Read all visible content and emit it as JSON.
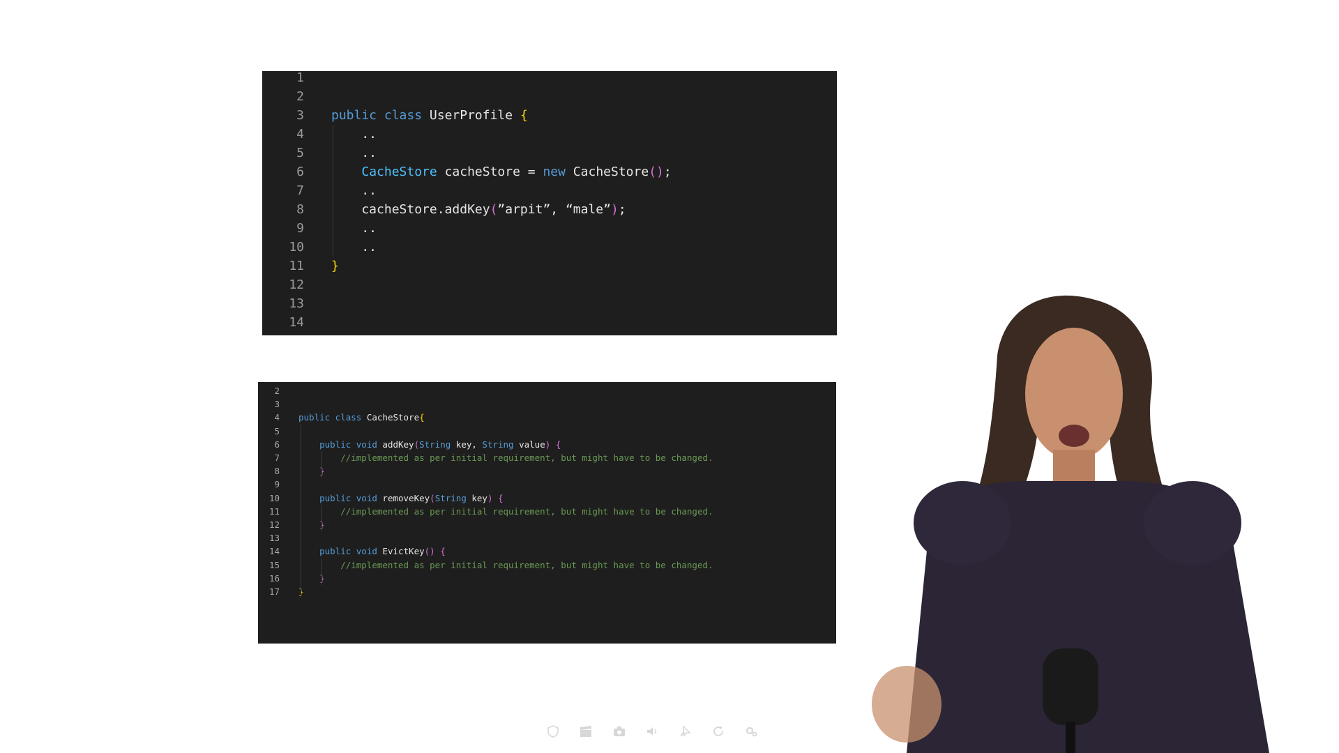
{
  "top_panel": {
    "lines": [
      {
        "n": "1",
        "tokens": []
      },
      {
        "n": "2",
        "tokens": []
      },
      {
        "n": "3",
        "tokens": [
          {
            "t": "public class ",
            "c": "kw"
          },
          {
            "t": "UserProfile ",
            "c": "tx"
          },
          {
            "t": "{",
            "c": "br"
          }
        ]
      },
      {
        "n": "4",
        "tokens": [
          {
            "t": "    ..",
            "c": "tx"
          }
        ]
      },
      {
        "n": "5",
        "tokens": [
          {
            "t": "    ..",
            "c": "tx"
          }
        ]
      },
      {
        "n": "6",
        "tokens": [
          {
            "t": "    ",
            "c": "tx"
          },
          {
            "t": "CacheStore",
            "c": "ty"
          },
          {
            "t": " cacheStore = ",
            "c": "tx"
          },
          {
            "t": "new",
            "c": "kw"
          },
          {
            "t": " CacheStore",
            "c": "tx"
          },
          {
            "t": "()",
            "c": "pr"
          },
          {
            "t": ";",
            "c": "tx"
          }
        ]
      },
      {
        "n": "7",
        "tokens": [
          {
            "t": "    ..",
            "c": "tx"
          }
        ]
      },
      {
        "n": "8",
        "tokens": [
          {
            "t": "    cacheStore.addKey",
            "c": "tx"
          },
          {
            "t": "(",
            "c": "pr"
          },
          {
            "t": "”arpit”, “male”",
            "c": "tx"
          },
          {
            "t": ")",
            "c": "pr"
          },
          {
            "t": ";",
            "c": "tx"
          }
        ]
      },
      {
        "n": "9",
        "tokens": [
          {
            "t": "    ..",
            "c": "tx"
          }
        ]
      },
      {
        "n": "10",
        "tokens": [
          {
            "t": "    ..",
            "c": "tx"
          }
        ]
      },
      {
        "n": "11",
        "tokens": [
          {
            "t": "}",
            "c": "br"
          }
        ]
      },
      {
        "n": "12",
        "tokens": []
      },
      {
        "n": "13",
        "tokens": []
      },
      {
        "n": "14",
        "tokens": []
      }
    ]
  },
  "bottom_panel": {
    "lines": [
      {
        "n": "2",
        "tokens": []
      },
      {
        "n": "3",
        "tokens": []
      },
      {
        "n": "4",
        "tokens": [
          {
            "t": "public class ",
            "c": "kw"
          },
          {
            "t": "CacheStore",
            "c": "tx"
          },
          {
            "t": "{",
            "c": "br"
          }
        ]
      },
      {
        "n": "5",
        "tokens": []
      },
      {
        "n": "6",
        "tokens": [
          {
            "t": "    public void ",
            "c": "kw"
          },
          {
            "t": "addKey",
            "c": "tx"
          },
          {
            "t": "(",
            "c": "pr"
          },
          {
            "t": "String",
            "c": "kw"
          },
          {
            "t": " key, ",
            "c": "tx"
          },
          {
            "t": "String",
            "c": "kw"
          },
          {
            "t": " value",
            "c": "tx"
          },
          {
            "t": ") {",
            "c": "pr"
          }
        ]
      },
      {
        "n": "7",
        "tokens": [
          {
            "t": "        //implemented as per initial requirement, but might have to be changed.",
            "c": "cm"
          }
        ]
      },
      {
        "n": "8",
        "tokens": [
          {
            "t": "    }",
            "c": "pr"
          }
        ]
      },
      {
        "n": "9",
        "tokens": []
      },
      {
        "n": "10",
        "tokens": [
          {
            "t": "    public void ",
            "c": "kw"
          },
          {
            "t": "removeKey",
            "c": "tx"
          },
          {
            "t": "(",
            "c": "pr"
          },
          {
            "t": "String",
            "c": "kw"
          },
          {
            "t": " key",
            "c": "tx"
          },
          {
            "t": ") {",
            "c": "pr"
          }
        ]
      },
      {
        "n": "11",
        "tokens": [
          {
            "t": "        //implemented as per initial requirement, but might have to be changed.",
            "c": "cm"
          }
        ]
      },
      {
        "n": "12",
        "tokens": [
          {
            "t": "    }",
            "c": "pr"
          }
        ]
      },
      {
        "n": "13",
        "tokens": []
      },
      {
        "n": "14",
        "tokens": [
          {
            "t": "    public void ",
            "c": "kw"
          },
          {
            "t": "EvictKey",
            "c": "tx"
          },
          {
            "t": "() {",
            "c": "pr"
          }
        ]
      },
      {
        "n": "15",
        "tokens": [
          {
            "t": "        //implemented as per initial requirement, but might have to be changed.",
            "c": "cm"
          }
        ]
      },
      {
        "n": "16",
        "tokens": [
          {
            "t": "    }",
            "c": "pr"
          }
        ]
      },
      {
        "n": "17",
        "tokens": [
          {
            "t": "}",
            "c": "br"
          }
        ]
      }
    ]
  },
  "player_toolbar": {
    "buttons": [
      {
        "name": "shield-button",
        "icon": "shield-icon"
      },
      {
        "name": "clapperboard-button",
        "icon": "clapperboard-icon"
      },
      {
        "name": "camera-button",
        "icon": "camera-icon"
      },
      {
        "name": "volume-button",
        "icon": "volume-icon"
      },
      {
        "name": "pin-button",
        "icon": "pin-icon"
      },
      {
        "name": "reload-button",
        "icon": "reload-icon"
      },
      {
        "name": "settings-button",
        "icon": "gear-icon"
      }
    ]
  },
  "colors": {
    "editor_background": "#1e1e1e",
    "keyword": "#569cd6",
    "type": "#4fc1ff",
    "brace": "#ffd700",
    "paren": "#d670d6",
    "comment": "#6a9955",
    "line_number": "#9a9a9a",
    "plain_text": "#e6e6e6"
  }
}
